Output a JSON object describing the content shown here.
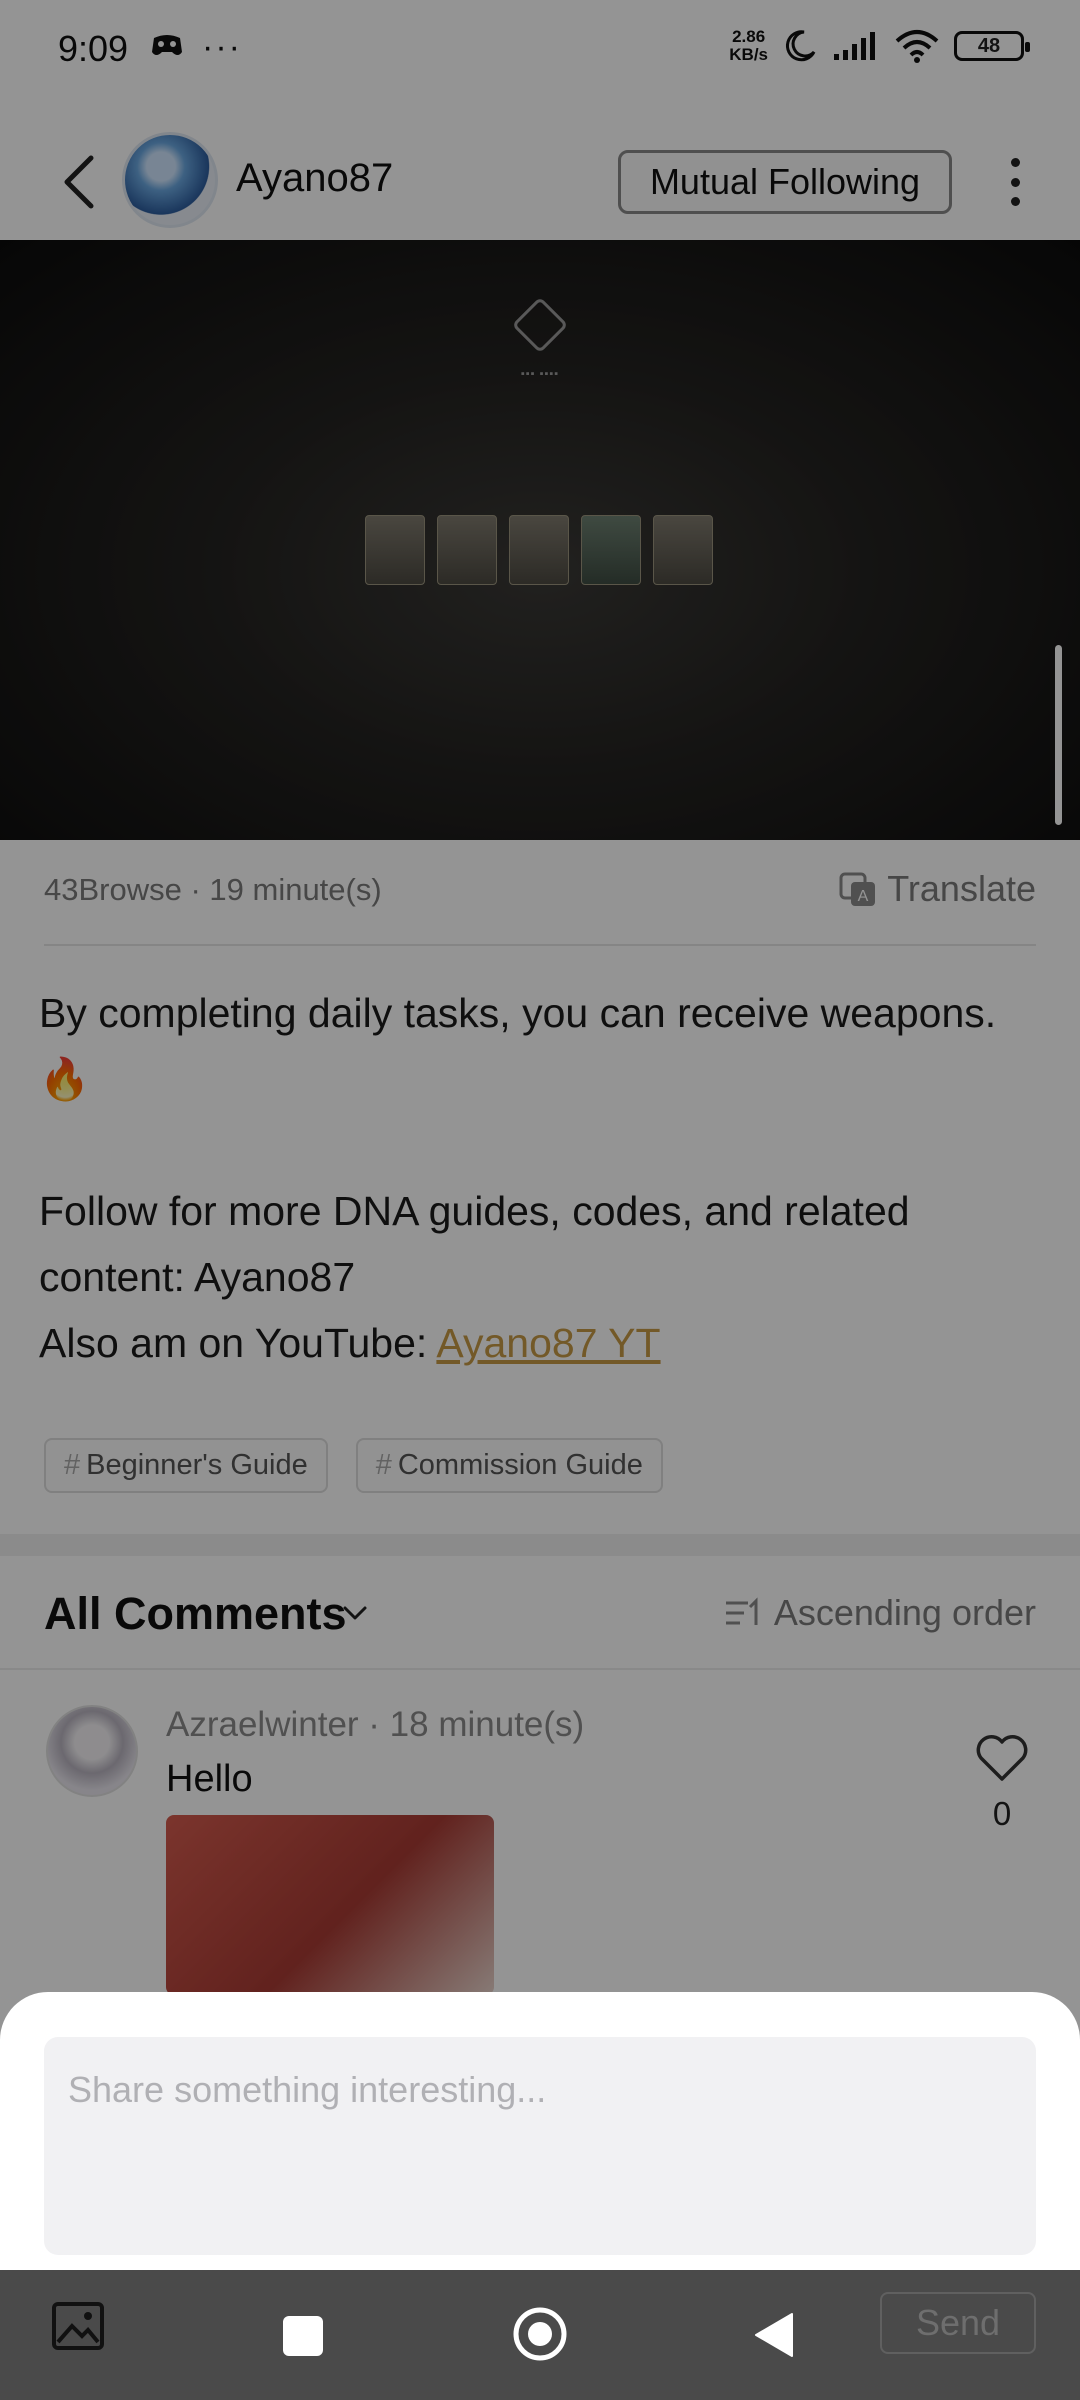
{
  "status_bar": {
    "time": "9:09",
    "speed_top": "2.86",
    "speed_bottom": "KB/s",
    "battery": "48",
    "icons": [
      "game-icon",
      "more-dots-icon",
      "moon-icon",
      "signal-icon",
      "wifi-icon",
      "battery-icon"
    ],
    "dots": "···"
  },
  "header": {
    "username": "Ayano87",
    "follow_label": "Mutual Following"
  },
  "post": {
    "meta": "43Browse · 19 minute(s)",
    "translate_label": "Translate",
    "line1": "By completing daily tasks, you can receive weapons.🔥",
    "line2": "Follow for more DNA guides, codes, and related content: Ayano87",
    "line3_prefix": "Also am on YouTube: ",
    "line3_link": "Ayano87 YT",
    "tags": [
      "Beginner's Guide",
      "Commission Guide"
    ]
  },
  "comments": {
    "title": "All Comments",
    "order_label": "Ascending order",
    "items": [
      {
        "meta": "Azraelwinter · 18 minute(s)",
        "text": "Hello",
        "likes": "0"
      }
    ]
  },
  "composer": {
    "placeholder": "Share something interesting...",
    "send_label": "Send"
  },
  "colors": {
    "link": "#c79a45",
    "overlay": "rgba(0,0,0,0.42)",
    "navbar": "#4a4a4a"
  }
}
